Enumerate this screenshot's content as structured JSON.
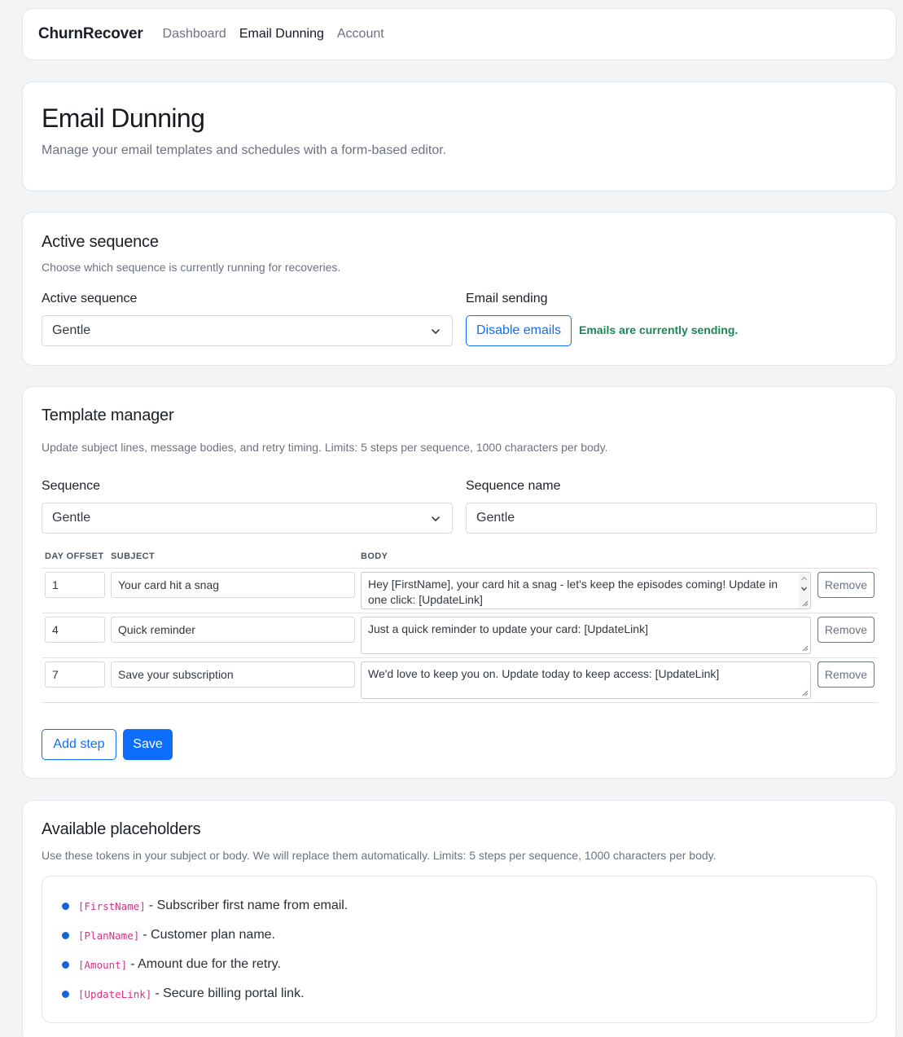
{
  "nav": {
    "brand": "ChurnRecover",
    "links": [
      "Dashboard",
      "Email Dunning",
      "Account"
    ],
    "active": "Email Dunning"
  },
  "hero": {
    "title": "Email Dunning",
    "subtitle": "Manage your email templates and schedules with a form-based editor."
  },
  "active_sequence": {
    "title": "Active sequence",
    "description": "Choose which sequence is currently running for recoveries.",
    "select_label": "Active sequence",
    "select_value": "Gentle",
    "sending_label": "Email sending",
    "disable_button": "Disable emails",
    "status_text": "Emails are currently sending.",
    "status_color": "#198754"
  },
  "template_manager": {
    "title": "Template manager",
    "description": "Update subject lines, message bodies, and retry timing. Limits: 5 steps per sequence, 1000 characters per body.",
    "sequence_label": "Sequence",
    "sequence_value": "Gentle",
    "name_label": "Sequence name",
    "name_value": "Gentle",
    "columns": [
      "DAY OFFSET",
      "SUBJECT",
      "BODY"
    ],
    "steps": [
      {
        "day": "1",
        "subject": "Your card hit a snag",
        "body": "Hey [FirstName], your card hit a snag - let's keep the episodes coming! Update in one click: [UpdateLink]",
        "remove": "Remove"
      },
      {
        "day": "4",
        "subject": "Quick reminder",
        "body": "Just a quick reminder to update your card: [UpdateLink]",
        "remove": "Remove"
      },
      {
        "day": "7",
        "subject": "Save your subscription",
        "body": "We'd love to keep you on. Update today to keep access: [UpdateLink]",
        "remove": "Remove"
      }
    ],
    "add_step": "Add step",
    "save": "Save"
  },
  "placeholders": {
    "title": "Available placeholders",
    "description": "Use these tokens in your subject or body. We will replace them automatically. Limits: 5 steps per sequence, 1000 characters per body.",
    "items": [
      {
        "token": "[FirstName]",
        "text": "- Subscriber first name from email."
      },
      {
        "token": "[PlanName]",
        "text": "- Customer plan name."
      },
      {
        "token": "[Amount]",
        "text": "- Amount due for the retry."
      },
      {
        "token": "[UpdateLink]",
        "text": "- Secure billing portal link."
      }
    ]
  },
  "colors": {
    "accent": "#0d6efd",
    "token": "#d63384",
    "bullet": "#1565d8"
  }
}
